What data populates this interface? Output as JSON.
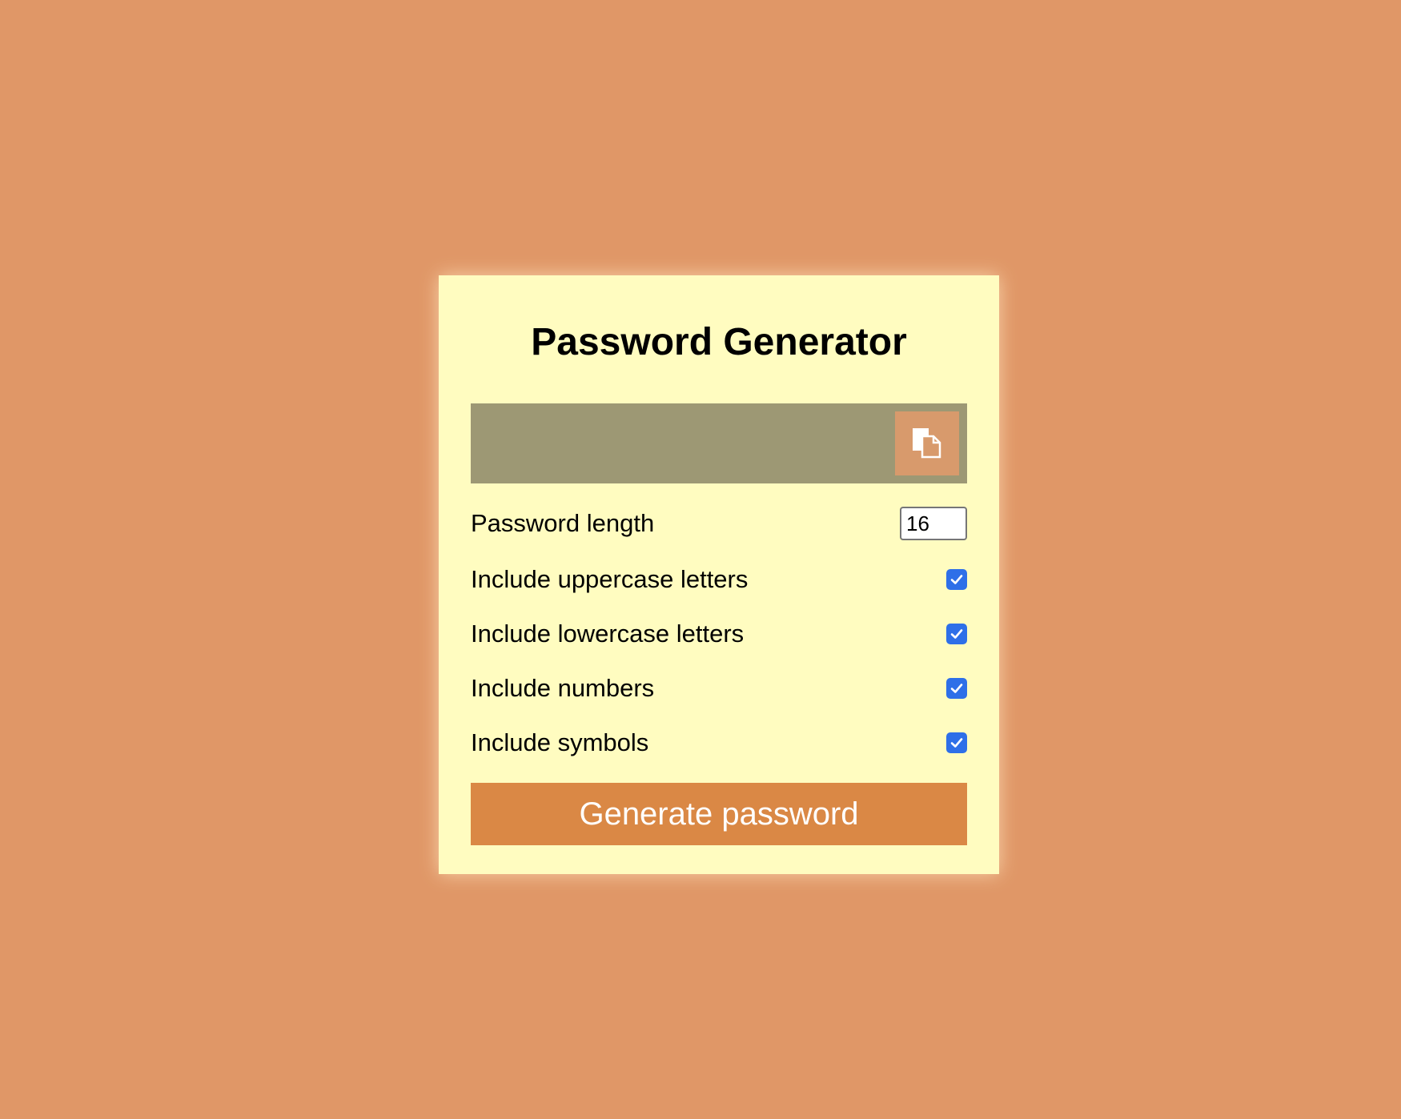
{
  "app": {
    "title": "Password Generator"
  },
  "result": {
    "value": "",
    "copy_icon": "copy-icon"
  },
  "options": {
    "length": {
      "label": "Password length",
      "value": "16"
    },
    "uppercase": {
      "label": "Include uppercase letters",
      "checked": true
    },
    "lowercase": {
      "label": "Include lowercase letters",
      "checked": true
    },
    "numbers": {
      "label": "Include numbers",
      "checked": true
    },
    "symbols": {
      "label": "Include symbols",
      "checked": true
    }
  },
  "actions": {
    "generate_label": "Generate password"
  },
  "colors": {
    "background": "#e09767",
    "card": "#fffcc0",
    "result_bar": "#9d9874",
    "copy_button": "#d89a6c",
    "checkbox": "#2e6fe8",
    "generate_button": "#da8845"
  }
}
